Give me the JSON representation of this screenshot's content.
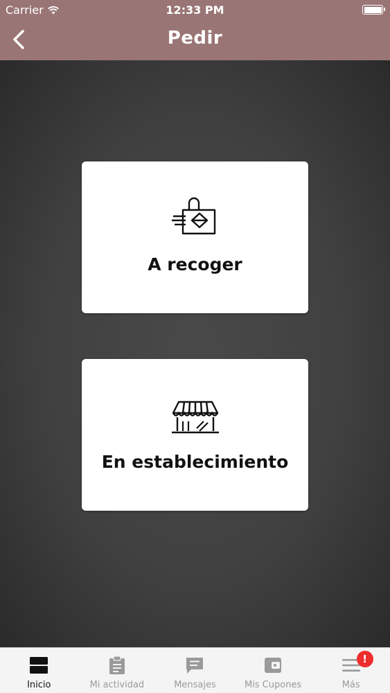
{
  "status_bar": {
    "carrier": "Carrier",
    "time": "12:33 PM"
  },
  "nav": {
    "title": "Pedir"
  },
  "options": [
    {
      "label": "A recoger",
      "icon": "shopping-bag-icon"
    },
    {
      "label": "En establecimiento",
      "icon": "storefront-icon"
    }
  ],
  "tabs": [
    {
      "label": "Inicio",
      "icon": "home-icon",
      "active": true
    },
    {
      "label": "Mi actividad",
      "icon": "clipboard-icon"
    },
    {
      "label": "Mensajes",
      "icon": "message-icon"
    },
    {
      "label": "Mis Cupones",
      "icon": "wallet-icon"
    },
    {
      "label": "Más",
      "icon": "menu-icon",
      "badge": "!"
    }
  ],
  "colors": {
    "header": "#9a7575",
    "background": "#3d3c3c",
    "card": "#ffffff",
    "badge": "#ee2d2d"
  }
}
